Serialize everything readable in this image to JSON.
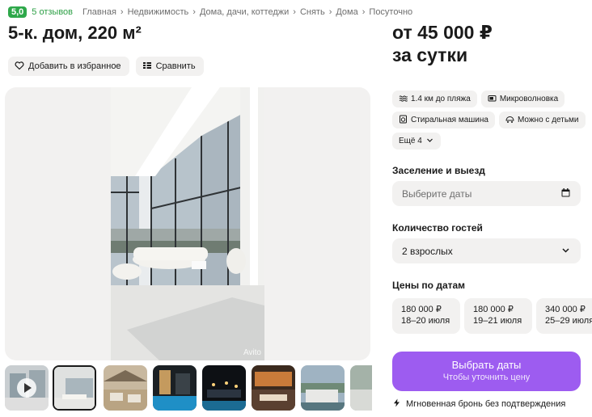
{
  "header": {
    "rating": "5,0",
    "reviews": "5 отзывов",
    "breadcrumbs": [
      "Главная",
      "Недвижимость",
      "Дома, дачи, коттеджи",
      "Снять",
      "Дома",
      "Посуточно"
    ],
    "separator": "›",
    "title": "5-к. дом, 220 м²"
  },
  "actions": {
    "favorite": "Добавить в избранное",
    "compare": "Сравнить"
  },
  "gallery": {
    "watermark": "Avito",
    "thumbnail_count": 8,
    "selected_thumbnail": 2
  },
  "offer": {
    "price": "от 45 000 ₽",
    "period": "за сутки"
  },
  "features": [
    {
      "icon": "waves-icon",
      "label": "1.4 км до пляжа"
    },
    {
      "icon": "microwave-icon",
      "label": "Микроволновка"
    },
    {
      "icon": "washing-machine-icon",
      "label": "Стиральная машина"
    },
    {
      "icon": "baby-icon",
      "label": "Можно с детьми"
    },
    {
      "icon": "chevron-down-icon",
      "label": "Ещё 4"
    }
  ],
  "booking": {
    "dates_label": "Заселение и выезд",
    "dates_placeholder": "Выберите даты",
    "guests_label": "Количество гостей",
    "guests_value": "2 взрослых",
    "prices_label": "Цены по датам",
    "price_cards": [
      {
        "price": "180 000 ₽",
        "dates": "18–20 июля"
      },
      {
        "price": "180 000 ₽",
        "dates": "19–21 июля"
      },
      {
        "price": "340 000 ₽",
        "dates": "25–29 июля"
      }
    ],
    "cta_main": "Выбрать даты",
    "cta_sub": "Чтобы уточнить цену",
    "instant": "Мгновенная бронь без подтверждения"
  },
  "colors": {
    "rating_green": "#2ea84a",
    "reviews_green": "#2c9f45",
    "cta_purple": "#9d5cf0",
    "chip_bg": "#f2f1f0"
  }
}
